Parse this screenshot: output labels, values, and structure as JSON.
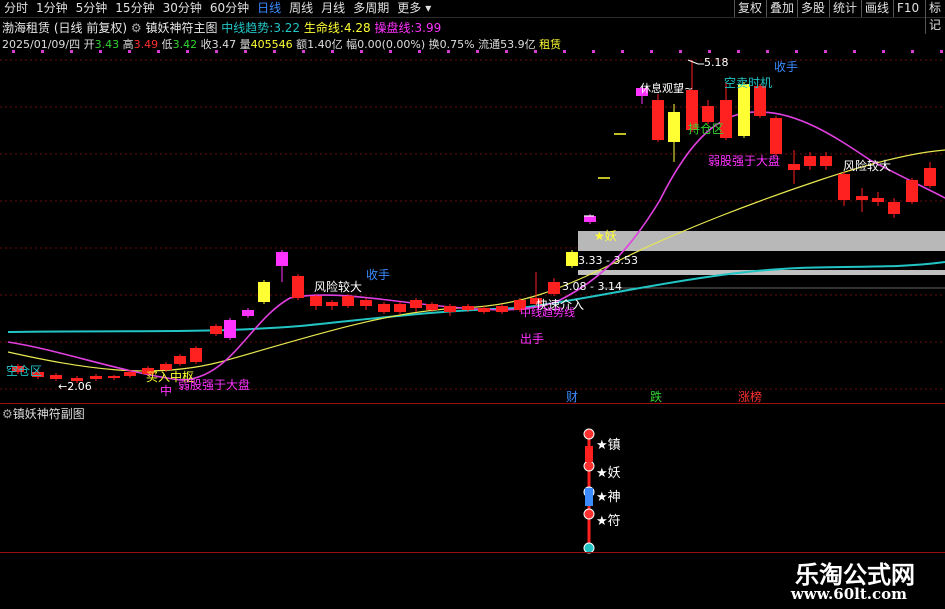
{
  "toolbar": {
    "tabs": [
      {
        "label": "分时",
        "active": false
      },
      {
        "label": "1分钟",
        "active": false
      },
      {
        "label": "5分钟",
        "active": false
      },
      {
        "label": "15分钟",
        "active": false
      },
      {
        "label": "30分钟",
        "active": false
      },
      {
        "label": "60分钟",
        "active": false
      },
      {
        "label": "日线",
        "active": true
      },
      {
        "label": "周线",
        "active": false
      },
      {
        "label": "月线",
        "active": false
      },
      {
        "label": "多周期",
        "active": false
      },
      {
        "label": "更多",
        "active": false
      }
    ],
    "right_tabs": [
      "复权",
      "叠加",
      "多股",
      "统计",
      "画线",
      "F10",
      "标记"
    ]
  },
  "header": {
    "stock": "渤海租赁",
    "mode": "(日线 前复权)",
    "indicator": "镇妖神符主图",
    "midline_label": "中线趋势:",
    "midline_value": "3.22",
    "life_label": "生命线:",
    "life_value": "4.28",
    "op_label": "操盘线:",
    "op_value": "3.99"
  },
  "quote": {
    "date": "2025/01/09/四",
    "open_label": "开",
    "open": "3.43",
    "high_label": "高",
    "high": "3.49",
    "low_label": "低",
    "low": "3.42",
    "close_label": "收",
    "close": "3.47",
    "vol_label": "量",
    "vol": "405546",
    "amount_label": "额",
    "amount": "1.40亿",
    "change_label": "幅",
    "change": "0.00(0.00%)",
    "turnover_label": "换",
    "turnover": "0.75%",
    "float_label": "流通",
    "float": "53.9亿",
    "tag": "租赁"
  },
  "main_labels": {
    "empty_zone": "空仓区",
    "low_price": "←2.06",
    "buy_center": "买入中枢",
    "weak": "弱股强于大盘",
    "mid": "中",
    "risk1": "风险较大",
    "collect1": "收手",
    "fast_buy": "快速介入",
    "lines": "中线趋势线",
    "out": "出手",
    "zone1": "3.33 - 3.53",
    "zone2": "3.08 - 3.14",
    "demon": "★妖",
    "rest": "休息观望~",
    "high_price": "5.18",
    "chance": "空卖时机",
    "collect2": "收手",
    "hold": "持仓区",
    "weak2": "弱股强于大盘",
    "risk2": "风险较大",
    "cai": "财",
    "die": "跌",
    "zhang": "涨榜"
  },
  "sub": {
    "title": "镇妖神符副图",
    "stars": [
      "★镇",
      "★妖",
      "★神",
      "★符"
    ]
  },
  "watermark": {
    "cn": "乐淘公式网",
    "url": "www.60lt.com"
  },
  "colors": {
    "up": "#ff2020",
    "down": "#ff2020",
    "yellow": "#ffff33",
    "magenta": "#ff33ff",
    "cyan": "#22c4c4",
    "pink": "#e040e0"
  }
}
